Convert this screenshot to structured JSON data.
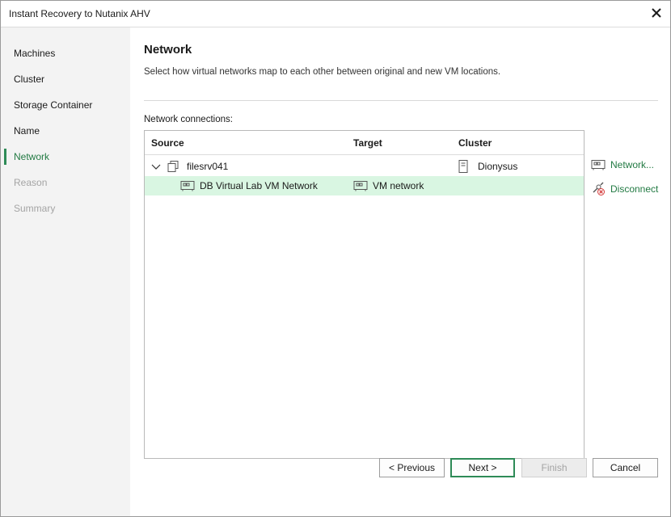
{
  "window": {
    "title": "Instant Recovery to Nutanix AHV"
  },
  "sidebar": {
    "steps": [
      {
        "label": "Machines",
        "state": "normal"
      },
      {
        "label": "Cluster",
        "state": "normal"
      },
      {
        "label": "Storage Container",
        "state": "normal"
      },
      {
        "label": "Name",
        "state": "normal"
      },
      {
        "label": "Network",
        "state": "active"
      },
      {
        "label": "Reason",
        "state": "disabled"
      },
      {
        "label": "Summary",
        "state": "disabled"
      }
    ]
  },
  "main": {
    "title": "Network",
    "description": "Select how virtual networks map to each other between original and new VM locations.",
    "connections_label": "Network connections:",
    "table": {
      "columns": [
        "Source",
        "Target",
        "Cluster"
      ],
      "rows": [
        {
          "source": "filesrv041",
          "target": "",
          "cluster": "Dionysus",
          "expanded": true,
          "selected": false
        },
        {
          "source": "DB Virtual Lab VM Network",
          "target": "VM network",
          "cluster": "",
          "selected": true
        }
      ]
    },
    "actions": {
      "network": "Network...",
      "disconnect": "Disconnect"
    }
  },
  "buttons": {
    "previous": "< Previous",
    "next": "Next >",
    "finish": "Finish",
    "cancel": "Cancel"
  },
  "colors": {
    "accent": "#227a43",
    "selected_row": "#d9f6e2",
    "sidebar_bg": "#f3f3f3"
  }
}
